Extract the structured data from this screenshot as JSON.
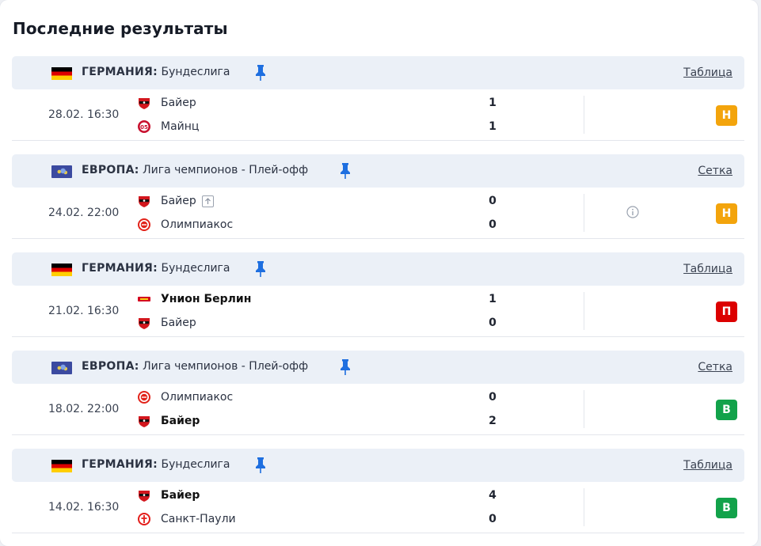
{
  "title": "Последние результаты",
  "colors": {
    "draw_badge": "#f3a40c",
    "loss_badge": "#dc0000",
    "win_badge": "#12a24a",
    "header_bg": "#ebf0f7",
    "pin": "#1e6fe0"
  },
  "sections": [
    {
      "flag": "germany-flag",
      "country": "ГЕРМАНИЯ:",
      "league": "Бундеслига",
      "link": "Таблица",
      "match": {
        "time": "28.02. 16:30",
        "home": {
          "name": "Байер",
          "crest": "bayer-crest",
          "score": "1",
          "bold": false
        },
        "away": {
          "name": "Майнц",
          "crest": "mainz-crest",
          "score": "1",
          "bold": false
        },
        "result": "Н",
        "result_type": "draw",
        "info_icon": false
      }
    },
    {
      "flag": "europe-flag",
      "country": "ЕВРОПА:",
      "league": "Лига чемпионов - Плей-офф",
      "link": "Сетка",
      "match": {
        "time": "24.02. 22:00",
        "home": {
          "name": "Байер",
          "crest": "bayer-crest",
          "score": "0",
          "bold": false,
          "advance_icon": true
        },
        "away": {
          "name": "Олимпиакос",
          "crest": "olympiacos-crest",
          "score": "0",
          "bold": false
        },
        "result": "Н",
        "result_type": "draw",
        "info_icon": true
      }
    },
    {
      "flag": "germany-flag",
      "country": "ГЕРМАНИЯ:",
      "league": "Бундеслига",
      "link": "Таблица",
      "match": {
        "time": "21.02. 16:30",
        "home": {
          "name": "Унион Берлин",
          "crest": "union-berlin-crest",
          "score": "1",
          "bold": true
        },
        "away": {
          "name": "Байер",
          "crest": "bayer-crest",
          "score": "0",
          "bold": false
        },
        "result": "П",
        "result_type": "loss",
        "info_icon": false
      }
    },
    {
      "flag": "europe-flag",
      "country": "ЕВРОПА:",
      "league": "Лига чемпионов - Плей-офф",
      "link": "Сетка",
      "match": {
        "time": "18.02. 22:00",
        "home": {
          "name": "Олимпиакос",
          "crest": "olympiacos-crest",
          "score": "0",
          "bold": false
        },
        "away": {
          "name": "Байер",
          "crest": "bayer-crest",
          "score": "2",
          "bold": true
        },
        "result": "В",
        "result_type": "win",
        "info_icon": false
      }
    },
    {
      "flag": "germany-flag",
      "country": "ГЕРМАНИЯ:",
      "league": "Бундеслига",
      "link": "Таблица",
      "match": {
        "time": "14.02. 16:30",
        "home": {
          "name": "Байер",
          "crest": "bayer-crest",
          "score": "4",
          "bold": true
        },
        "away": {
          "name": "Санкт-Паули",
          "crest": "st-pauli-crest",
          "score": "0",
          "bold": false
        },
        "result": "В",
        "result_type": "win",
        "info_icon": false
      }
    }
  ]
}
